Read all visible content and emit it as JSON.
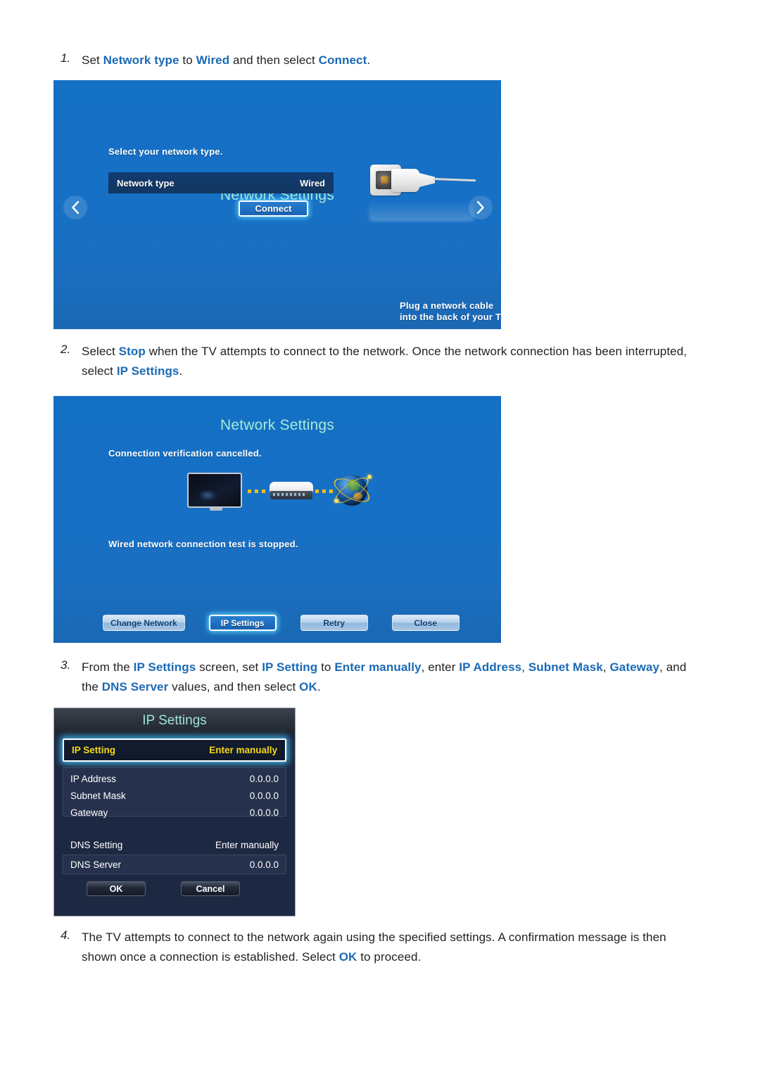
{
  "steps": [
    {
      "number": "1.",
      "segments": [
        {
          "t": "Set ",
          "hl": false
        },
        {
          "t": "Network type",
          "hl": true
        },
        {
          "t": " to ",
          "hl": false
        },
        {
          "t": "Wired",
          "hl": true
        },
        {
          "t": " and then select ",
          "hl": false
        },
        {
          "t": "Connect",
          "hl": true
        },
        {
          "t": ".",
          "hl": false
        }
      ]
    },
    {
      "number": "2.",
      "segments": [
        {
          "t": "Select ",
          "hl": false
        },
        {
          "t": "Stop",
          "hl": true
        },
        {
          "t": " when the TV attempts to connect to the network. Once the network connection has been interrupted, select ",
          "hl": false
        },
        {
          "t": "IP Settings",
          "hl": true
        },
        {
          "t": ".",
          "hl": false
        }
      ]
    },
    {
      "number": "3.",
      "segments": [
        {
          "t": "From the ",
          "hl": false
        },
        {
          "t": "IP Settings",
          "hl": true
        },
        {
          "t": " screen, set ",
          "hl": false
        },
        {
          "t": "IP Setting",
          "hl": true
        },
        {
          "t": " to ",
          "hl": false
        },
        {
          "t": "Enter manually",
          "hl": true
        },
        {
          "t": ", enter ",
          "hl": false
        },
        {
          "t": "IP Address",
          "hl": true
        },
        {
          "t": ", ",
          "hl": false
        },
        {
          "t": "Subnet Mask",
          "hl": true
        },
        {
          "t": ", ",
          "hl": false
        },
        {
          "t": "Gateway",
          "hl": true
        },
        {
          "t": ", and the ",
          "hl": false
        },
        {
          "t": "DNS Server",
          "hl": true
        },
        {
          "t": " values, and then select ",
          "hl": false
        },
        {
          "t": "OK",
          "hl": true
        },
        {
          "t": ".",
          "hl": false
        }
      ]
    },
    {
      "number": "4.",
      "segments": [
        {
          "t": "The TV attempts to connect to the network again using the specified settings. A confirmation message is then shown once a connection is established. Select ",
          "hl": false
        },
        {
          "t": "OK",
          "hl": true
        },
        {
          "t": " to proceed.",
          "hl": false
        }
      ]
    }
  ],
  "screen1": {
    "title": "Network Settings",
    "subtext": "Select your network type.",
    "network_type_label": "Network type",
    "network_type_value": "Wired",
    "connect_button": "Connect",
    "cable_caption": "Plug a network cable into the back of your TV.",
    "prev_icon": "chevron-left-icon",
    "next_icon": "chevron-right-icon",
    "title_color": "#a6e8d6",
    "bg_color": "#1670c6"
  },
  "screen2": {
    "title": "Network Settings",
    "message_top": "Connection verification cancelled.",
    "message_bottom": "Wired network connection test is stopped.",
    "buttons": [
      {
        "label": "Change Network",
        "selected": false
      },
      {
        "label": "IP Settings",
        "selected": true
      },
      {
        "label": "Retry",
        "selected": false
      },
      {
        "label": "Close",
        "selected": false
      }
    ],
    "title_color": "#a6e8d6",
    "selected_button_color": "#1862b2"
  },
  "ip_settings": {
    "title": "IP Settings",
    "highlighted_row": {
      "label": "IP Setting",
      "value": "Enter manually",
      "text_color": "#f5d916"
    },
    "rows": [
      {
        "label": "IP Address",
        "value": "0.0.0.0"
      },
      {
        "label": "Subnet Mask",
        "value": "0.0.0.0"
      },
      {
        "label": "Gateway",
        "value": "0.0.0.0"
      },
      {
        "label": "DNS Setting",
        "value": "Enter manually"
      },
      {
        "label": "DNS Server",
        "value": "0.0.0.0"
      }
    ],
    "ok_button": "OK",
    "cancel_button": "Cancel",
    "title_color": "#9fe4d4",
    "bg_color": "#1d2842"
  }
}
